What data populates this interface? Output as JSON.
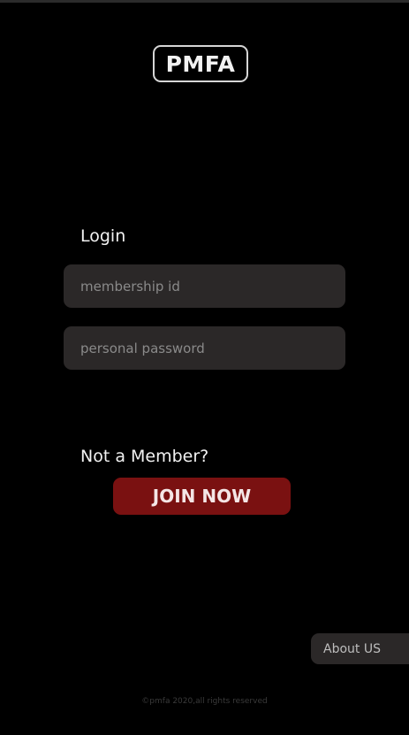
{
  "header": {
    "logo_text": "PMFA"
  },
  "login": {
    "title": "Login",
    "membership_placeholder": "membership id",
    "password_placeholder": "personal password"
  },
  "signup": {
    "prompt": "Not a Member?",
    "join_label": "JOIN NOW"
  },
  "nav": {
    "about_label": "About US"
  },
  "footer": {
    "copyright": "©pmfa 2020,all rights reserved"
  },
  "colors": {
    "background": "#000000",
    "field_bg": "#2b2828",
    "join_button_bg": "#7a1111"
  }
}
